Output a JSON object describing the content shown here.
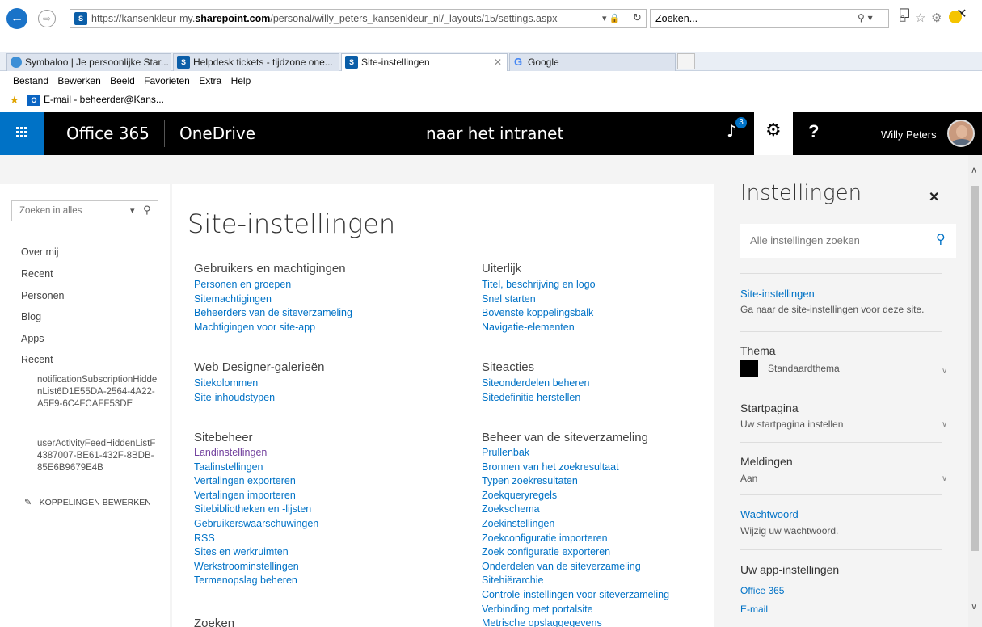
{
  "browser": {
    "url_prefix": "https://kansenkleur-my.",
    "url_domain": "sharepoint.com",
    "url_suffix": "/personal/willy_peters_kansenkleur_nl/_layouts/15/settings.aspx",
    "search_placeholder": "Zoeken...",
    "tabs": [
      {
        "label": "Symbaloo | Je persoonlijke Star...",
        "icon": "symbaloo-icon"
      },
      {
        "label": "Helpdesk tickets - tijdzone one...",
        "icon": "sharepoint-icon"
      },
      {
        "label": "Site-instellingen",
        "icon": "sharepoint-icon",
        "active": true
      },
      {
        "label": "Google",
        "icon": "google-icon"
      }
    ],
    "menu": [
      "Bestand",
      "Bewerken",
      "Beeld",
      "Favorieten",
      "Extra",
      "Help"
    ],
    "favorites": [
      "E-mail - beheerder@Kans..."
    ]
  },
  "suitebar": {
    "brand": "Office 365",
    "app": "OneDrive",
    "center_link": "naar het intranet",
    "notification_count": "3",
    "help": "?",
    "user_name": "Willy Peters"
  },
  "leftnav": {
    "search_placeholder": "Zoeken in alles",
    "items": [
      "Over mij",
      "Recent",
      "Personen",
      "Blog",
      "Apps",
      "Recent"
    ],
    "sub_items": [
      "notificationSubscriptionHiddenList6D1E55DA-2564-4A22-A5F9-6C4FCAFF53DE",
      "userActivityFeedHiddenListF4387007-BE61-432F-8BDB-85E6B9679E4B"
    ],
    "edit_links": "KOPPELINGEN BEWERKEN"
  },
  "main": {
    "title": "Site-instellingen",
    "sections_left": [
      {
        "heading": "Gebruikers en machtigingen",
        "links": [
          "Personen en groepen",
          "Sitemachtigingen",
          "Beheerders van de siteverzameling",
          "Machtigingen voor site-app"
        ]
      },
      {
        "heading": "Web Designer-galerieën",
        "links": [
          "Sitekolommen",
          "Site-inhoudstypen"
        ]
      },
      {
        "heading": "Sitebeheer",
        "links": [
          "Landinstellingen",
          "Taalinstellingen",
          "Vertalingen exporteren",
          "Vertalingen importeren",
          "Sitebibliotheken en -lijsten",
          "Gebruikerswaarschuwingen",
          "RSS",
          "Sites en werkruimten",
          "Werkstroominstellingen",
          "Termenopslag beheren"
        ]
      },
      {
        "heading": "Zoeken",
        "links": []
      }
    ],
    "sections_right": [
      {
        "heading": "Uiterlijk",
        "links": [
          "Titel, beschrijving en logo",
          "Snel starten",
          "Bovenste koppelingsbalk",
          "Navigatie-elementen"
        ]
      },
      {
        "heading": "Siteacties",
        "links": [
          "Siteonderdelen beheren",
          "Sitedefinitie herstellen"
        ]
      },
      {
        "heading": "Beheer van de siteverzameling",
        "links": [
          "Prullenbak",
          "Bronnen van het zoekresultaat",
          "Typen zoekresultaten",
          "Zoekqueryregels",
          "Zoekschema",
          "Zoekinstellingen",
          "Zoekconfiguratie importeren",
          "Zoek configuratie exporteren",
          "Onderdelen van de siteverzameling",
          "Sitehiërarchie",
          "Controle-instellingen voor siteverzameling",
          "Verbinding met portalsite",
          "Metrische opslaggegevens"
        ]
      }
    ]
  },
  "panel": {
    "title": "Instellingen",
    "search_placeholder": "Alle instellingen zoeken",
    "site_settings_link": "Site-instellingen",
    "site_settings_desc": "Ga naar de site-instellingen voor deze site.",
    "theme_heading": "Thema",
    "theme_value": "Standaardthema",
    "start_heading": "Startpagina",
    "start_value": "Uw startpagina instellen",
    "notif_heading": "Meldingen",
    "notif_value": "Aan",
    "password_link": "Wachtwoord",
    "password_desc": "Wijzig uw wachtwoord.",
    "app_heading": "Uw app-instellingen",
    "app_links": [
      "Office 365",
      "E-mail"
    ]
  }
}
